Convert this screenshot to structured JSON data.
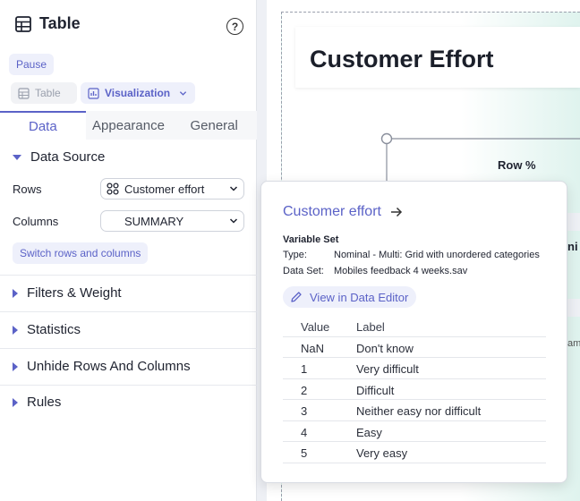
{
  "panel": {
    "title": "Table",
    "help_label": "?",
    "pause_label": "Pause",
    "view_table_label": "Table",
    "view_viz_label": "Visualization",
    "tabs": [
      "Data",
      "Appearance",
      "General"
    ],
    "data_source": {
      "heading": "Data Source",
      "rows_label": "Rows",
      "rows_value": "Customer effort",
      "columns_label": "Columns",
      "columns_value": "SUMMARY",
      "switch_label": "Switch rows and columns"
    },
    "sections": [
      "Filters & Weight",
      "Statistics",
      "Unhide Rows And Columns",
      "Rules"
    ]
  },
  "canvas": {
    "title": "Customer Effort",
    "row_pct_label": "Row %",
    "frag_right": "ni",
    "frag_bottom": "am"
  },
  "popup": {
    "title": "Customer effort",
    "variable_set_label": "Variable Set",
    "type_key": "Type:",
    "type_value": "Nominal - Multi: Grid with unordered categories",
    "dataset_key": "Data Set:",
    "dataset_value": "Mobiles feedback 4 weeks.sav",
    "view_editor_label": "View in Data Editor",
    "columns": [
      "Value",
      "Label"
    ],
    "rows": [
      {
        "value": "NaN",
        "label": "Don't know"
      },
      {
        "value": "1",
        "label": "Very difficult"
      },
      {
        "value": "2",
        "label": "Difficult"
      },
      {
        "value": "3",
        "label": "Neither easy nor difficult"
      },
      {
        "value": "4",
        "label": "Easy"
      },
      {
        "value": "5",
        "label": "Very easy"
      }
    ]
  },
  "colors": {
    "accent": "#5b62c7",
    "accent_bg": "#eef0fb",
    "canvas_tint": "#dff3ee"
  }
}
